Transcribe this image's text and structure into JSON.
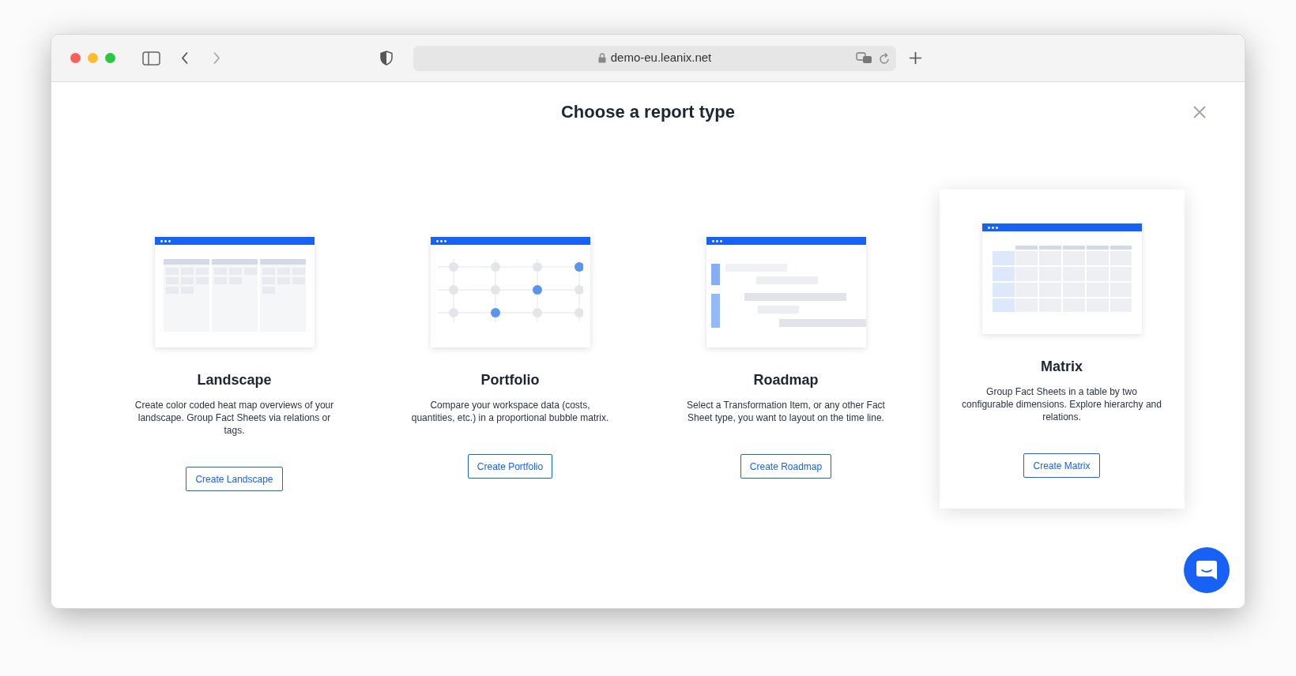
{
  "browser": {
    "url": "demo-eu.leanix.net"
  },
  "dialog": {
    "title": "Choose a report type"
  },
  "report_types": [
    {
      "kind": "landscape",
      "title": "Landscape",
      "description": "Create color coded heat map overviews of your landscape. Group Fact Sheets via relations or tags.",
      "button": "Create Landscape",
      "highlighted": false
    },
    {
      "kind": "portfolio",
      "title": "Portfolio",
      "description": "Compare your workspace data (costs, quantities, etc.) in a proportional bubble matrix.",
      "button": "Create Portfolio",
      "highlighted": false
    },
    {
      "kind": "roadmap",
      "title": "Roadmap",
      "description": "Select a Transformation Item, or any other Fact Sheet type, you want to layout on the time line.",
      "button": "Create Roadmap",
      "highlighted": false
    },
    {
      "kind": "matrix",
      "title": "Matrix",
      "description": "Group Fact Sheets in a table by two configurable dimensions. Explore hierarchy and relations.",
      "button": "Create Matrix",
      "highlighted": true
    }
  ]
}
